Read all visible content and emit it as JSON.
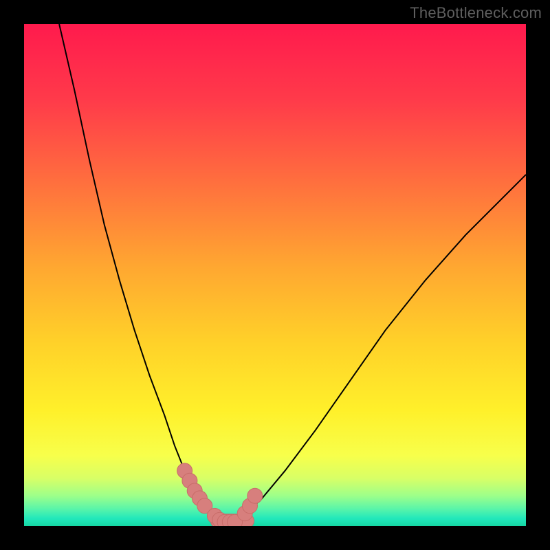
{
  "watermark": "TheBottleneck.com",
  "colors": {
    "black": "#000000",
    "curve": "#000000",
    "marker_fill": "#d77f7d",
    "marker_stroke": "#c86c69",
    "gradient_stops": [
      {
        "offset": 0.0,
        "color": "#ff1a4d"
      },
      {
        "offset": 0.15,
        "color": "#ff3a4a"
      },
      {
        "offset": 0.3,
        "color": "#ff6a3f"
      },
      {
        "offset": 0.48,
        "color": "#ffa631"
      },
      {
        "offset": 0.63,
        "color": "#ffd029"
      },
      {
        "offset": 0.77,
        "color": "#fff02a"
      },
      {
        "offset": 0.86,
        "color": "#f7ff4b"
      },
      {
        "offset": 0.905,
        "color": "#d8ff66"
      },
      {
        "offset": 0.94,
        "color": "#9dff8a"
      },
      {
        "offset": 0.965,
        "color": "#5cf5a8"
      },
      {
        "offset": 0.985,
        "color": "#22e8bb"
      },
      {
        "offset": 1.0,
        "color": "#15d7a4"
      }
    ]
  },
  "chart_data": {
    "type": "line",
    "title": "",
    "xlabel": "",
    "ylabel": "",
    "x_range": [
      0,
      100
    ],
    "y_range": [
      0,
      100
    ],
    "note": "Values below are estimated from pixel gridlines at ~5% precision.",
    "series": [
      {
        "name": "bottleneck-curve-left",
        "x": [
          7,
          10,
          13,
          16,
          19,
          22,
          25,
          28,
          30,
          32,
          34,
          36,
          38,
          40
        ],
        "y": [
          100,
          87,
          73,
          60,
          49,
          39,
          30,
          22,
          16,
          11,
          7,
          4,
          1.5,
          0.5
        ]
      },
      {
        "name": "bottleneck-curve-right",
        "x": [
          40,
          43,
          47,
          52,
          58,
          65,
          72,
          80,
          88,
          96,
          100
        ],
        "y": [
          0.5,
          2,
          5,
          11,
          19,
          29,
          39,
          49,
          58,
          66,
          70
        ]
      },
      {
        "name": "optimal-zone-markers",
        "kind": "marker-band",
        "x": [
          32,
          33,
          34,
          35,
          36,
          38,
          39,
          40,
          41,
          42,
          44,
          45,
          46
        ],
        "y": [
          11,
          9,
          7,
          5.5,
          4,
          2,
          1.2,
          0.8,
          0.8,
          0.8,
          2.5,
          4,
          6
        ]
      }
    ]
  }
}
